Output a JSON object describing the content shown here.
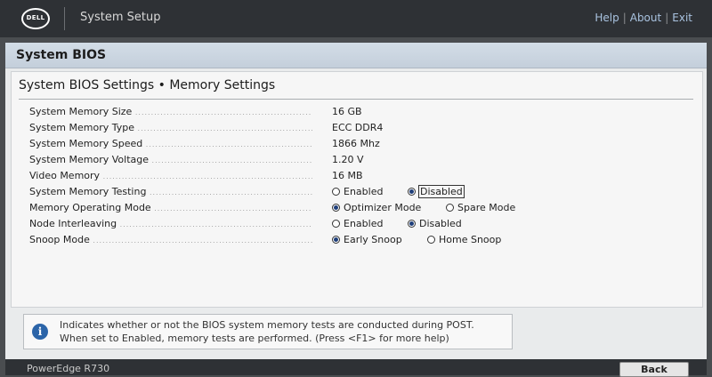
{
  "header": {
    "logo_text": "DELL",
    "app_title": "System Setup",
    "links": [
      "Help",
      "About",
      "Exit"
    ]
  },
  "page_title": "System BIOS",
  "section_title": "System BIOS Settings • Memory Settings",
  "settings": {
    "memory_size": {
      "label": "System Memory Size",
      "value": "16 GB"
    },
    "memory_type": {
      "label": "System Memory Type",
      "value": "ECC DDR4"
    },
    "memory_speed": {
      "label": "System Memory Speed",
      "value": "1866 Mhz"
    },
    "memory_voltage": {
      "label": "System Memory Voltage",
      "value": "1.20 V"
    },
    "video_memory": {
      "label": "Video Memory",
      "value": "16 MB"
    },
    "memory_testing": {
      "label": "System Memory Testing",
      "options": [
        "Enabled",
        "Disabled"
      ],
      "selected": "Disabled"
    },
    "operating_mode": {
      "label": "Memory Operating Mode",
      "options": [
        "Optimizer Mode",
        "Spare Mode"
      ],
      "selected": "Optimizer Mode"
    },
    "node_interleaving": {
      "label": "Node Interleaving",
      "options": [
        "Enabled",
        "Disabled"
      ],
      "selected": "Disabled"
    },
    "snoop_mode": {
      "label": "Snoop Mode",
      "options": [
        "Early Snoop",
        "Home Snoop"
      ],
      "selected": "Early Snoop"
    }
  },
  "help_box": {
    "icon": "info-icon",
    "line1": "Indicates whether or not the BIOS system memory tests are conducted during POST.",
    "line2": "When set to Enabled, memory tests are performed. (Press <F1> for more help)"
  },
  "footer": {
    "model": "PowerEdge R730",
    "back_label": "Back"
  }
}
